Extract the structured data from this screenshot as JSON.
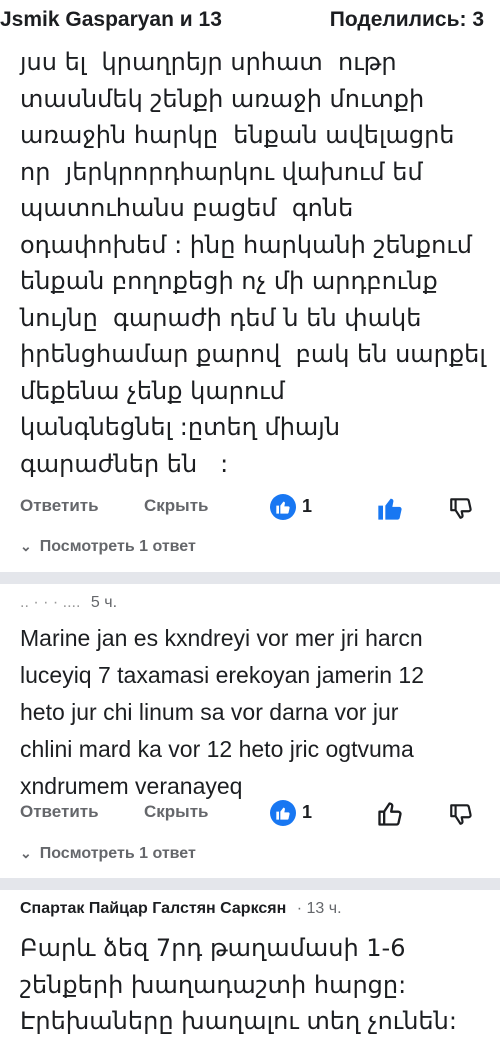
{
  "header": {
    "author_group": "Jsmik Gasparyan и 13",
    "shared": "Поделились: 3"
  },
  "comment1": {
    "text": "յսս ել  կրաղրեյր սրհատ  ութր\nտասնմեկ շենքի առաջի մուտքի\nառաջին հարկը  ենքան ավելացրե\nոր  յերկրորդհարկու վախում եմ\nպատուհանս բացեմ  գոնե\nօդափոխեմ : ինը հարկանի շենքում\nենքան բողոքեցի ոչ մի արդբունք\nնույնը  գարաժի դեմ ն են փակե\nիրենցհամար քարով  բակ են սարքել\nմեքենա չենք կարում\nկանգնեցնել :ըտեղ միայն\nգարաժներ են   :",
    "reply_label": "Ответить",
    "hide_label": "Скрыть",
    "like_count": "1",
    "view_replies": "Посмотреть 1 ответ"
  },
  "comment2": {
    "author": "..  ·  ·    ·  ....",
    "time": "5 ч.",
    "text": "Marine jan es kxndreyi vor mer jri harcn\nluceyiq 7 taxamasi erekoyan jamerin 12\nheto jur chi linum sa vor darna vor jur\nchlini mard ka vor 12 heto jric ogtvuma\nxndrumem veranayeq",
    "reply_label": "Ответить",
    "hide_label": "Скрыть",
    "like_count": "1",
    "view_replies": "Посмотреть 1 ответ"
  },
  "comment3": {
    "author": "Спартак Пайцар Галстян Сарксян",
    "time": "· 13 ч.",
    "text": "Բարև ձեզ 7րդ թաղամասի 1-6\nշենքերի խաղադաշտի հարցը:\nԷրեխաները խաղալու տեղ չունեն:"
  },
  "colors": {
    "like_blue": "#1877f2",
    "muted_gray": "#65676b",
    "text": "#1c1e21",
    "divider": "#e4e6eb"
  }
}
